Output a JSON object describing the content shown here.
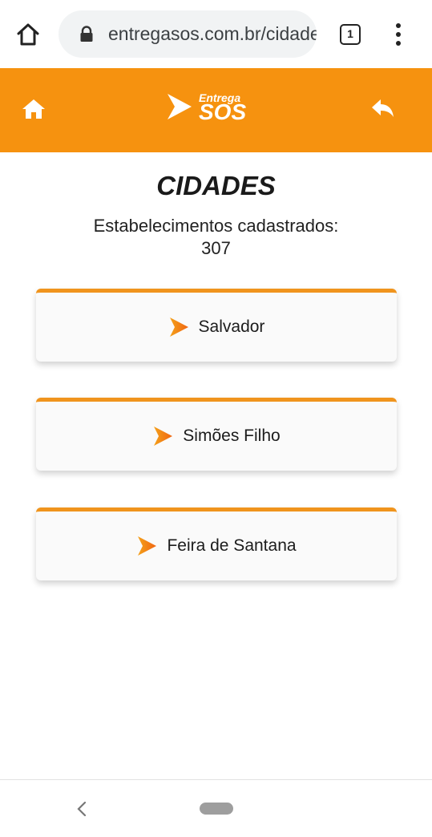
{
  "browser": {
    "url": "entregasos.com.br/cidades",
    "tab_count": "1",
    "icons": [
      "home-icon",
      "lock-icon",
      "tabs-icon",
      "more-vert-icon"
    ]
  },
  "header": {
    "logo_top": "Entrega",
    "logo_main": "SOS",
    "icons": [
      "home-icon",
      "reply-icon"
    ],
    "background_color": "#f6920f"
  },
  "main": {
    "title": "CIDADES",
    "count_label": "Estabelecimentos cadastrados:",
    "count_value": "307",
    "cities": [
      {
        "label": "Salvador"
      },
      {
        "label": "Simões Filho"
      },
      {
        "label": "Feira de Santana"
      }
    ],
    "accent_color": "#f0941d"
  },
  "system_nav": {
    "icons": [
      "back-chevron-icon",
      "home-pill-icon"
    ]
  }
}
